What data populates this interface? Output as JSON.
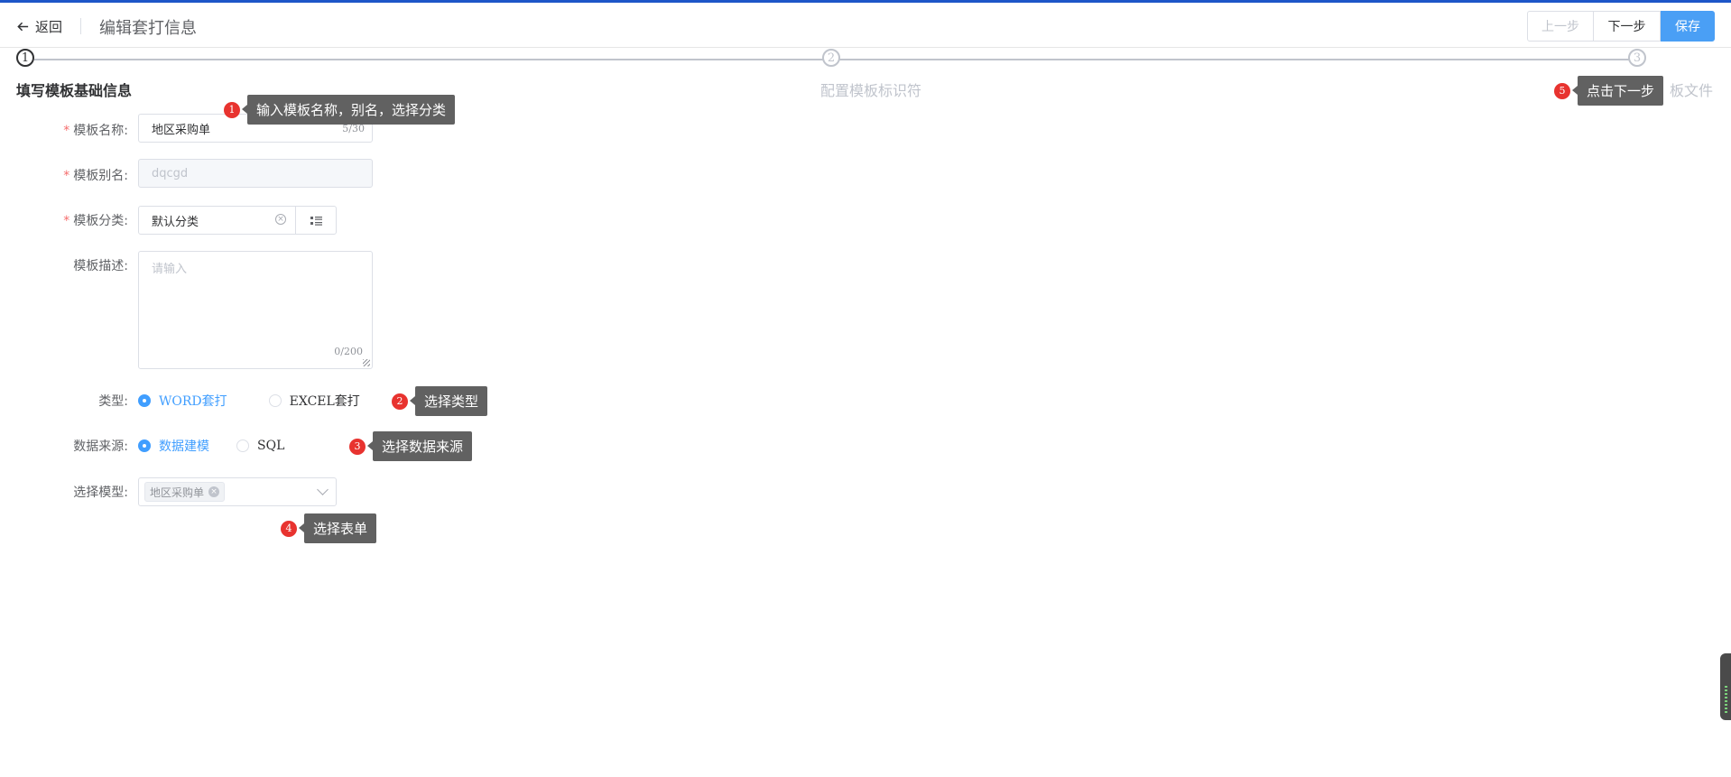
{
  "header": {
    "back_label": "返回",
    "title": "编辑套打信息",
    "prev_label": "上一步",
    "next_label": "下一步",
    "save_label": "保存"
  },
  "steps": [
    {
      "num": "1",
      "title": "填写模板基础信息",
      "active": true
    },
    {
      "num": "2",
      "title": "配置模板标识符",
      "active": false
    },
    {
      "num": "3",
      "title": "板文件",
      "active": false
    }
  ],
  "form": {
    "name_label": "模板名称:",
    "name_value": "地区采购单",
    "name_count": "5/30",
    "alias_label": "模板别名:",
    "alias_value": "dqcgd",
    "category_label": "模板分类:",
    "category_value": "默认分类",
    "desc_label": "模板描述:",
    "desc_placeholder": "请输入",
    "desc_count": "0/200",
    "type_label": "类型:",
    "type_options": [
      "WORD套打",
      "EXCEL套打"
    ],
    "type_selected": "WORD套打",
    "source_label": "数据来源:",
    "source_options": [
      "数据建模",
      "SQL"
    ],
    "source_selected": "数据建模",
    "model_label": "选择模型:",
    "model_tag": "地区采购单"
  },
  "hints": [
    {
      "num": "1",
      "text": "输入模板名称，别名，选择分类"
    },
    {
      "num": "2",
      "text": "选择类型"
    },
    {
      "num": "3",
      "text": "选择数据来源"
    },
    {
      "num": "4",
      "text": "选择表单"
    },
    {
      "num": "5",
      "text": "点击下一步"
    }
  ],
  "colors": {
    "primary": "#409eff",
    "save_button": "#4a9ff5",
    "required": "#f56c6c",
    "hint_badge": "#e8332f",
    "hint_bubble": "#616161",
    "top_accent": "#1e56c8"
  }
}
